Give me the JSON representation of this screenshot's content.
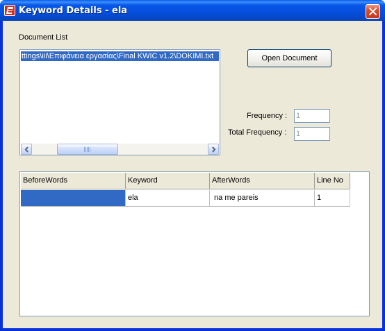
{
  "window": {
    "title": "Keyword Details - ela"
  },
  "document_list": {
    "label": "Document List",
    "items": [
      "ttings\\iii\\Επιφάνεια εργασίας\\Final KWIC v1.2\\DOKIMI.txt"
    ],
    "selected_index": 0
  },
  "buttons": {
    "open_document": "Open Document"
  },
  "frequency": {
    "label": "Frequency :",
    "value": "1"
  },
  "total_frequency": {
    "label": "Total Frequency :",
    "value": "1"
  },
  "results_table": {
    "columns": [
      "BeforeWords",
      "Keyword",
      "AfterWords",
      "Line No"
    ],
    "rows": [
      [
        "",
        "ela",
        " na me pareis",
        "1"
      ]
    ]
  },
  "colors": {
    "titlebar": "#0554e0",
    "selection": "#316ac5",
    "dialog_bg": "#ece9d8"
  },
  "icons": {
    "app": "document-app-icon",
    "close": "close-icon",
    "scroll_left": "arrow-left-icon",
    "scroll_right": "arrow-right-icon"
  }
}
